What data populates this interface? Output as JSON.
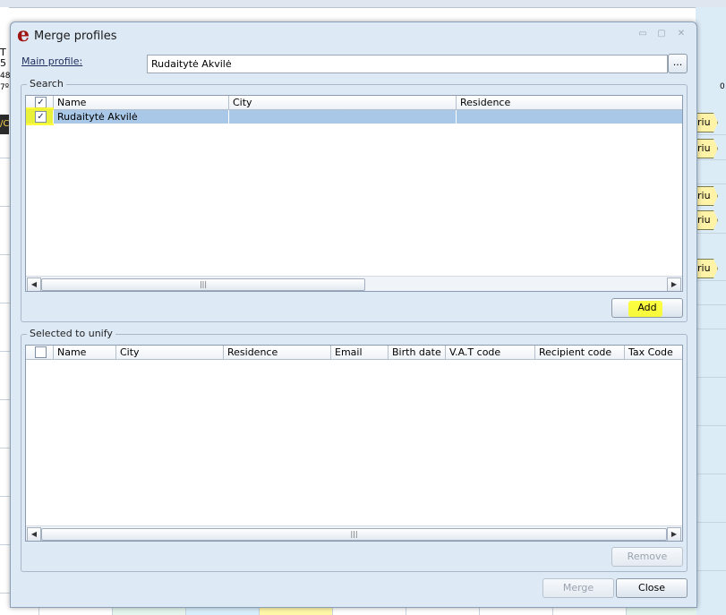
{
  "background": {
    "left_text": [
      "T",
      "5",
      "48",
      "7º"
    ],
    "dark_bar_text": "/C",
    "right_number": "0",
    "tags": [
      "riu",
      "riu",
      "riu",
      "riu",
      "riu"
    ]
  },
  "dialog": {
    "title": "Merge profiles",
    "logo_letter": "e",
    "window_controls": {
      "minimize": "▭",
      "maximize": "▢",
      "close": "✕"
    },
    "main_profile": {
      "label": "Main profile:",
      "value": "Rudaitytė Akvilė",
      "browse_label": "..."
    },
    "search": {
      "title": "Search",
      "columns": [
        "Name",
        "City",
        "Residence"
      ],
      "rows": [
        {
          "checked": true,
          "name": "Rudaitytė Akvilė",
          "city": "",
          "residence": ""
        }
      ],
      "add_button": "Add",
      "scroll_thumb_glyph": "|||"
    },
    "selected": {
      "title": "Selected to unify",
      "columns": [
        "Name",
        "City",
        "Residence",
        "Email",
        "Birth date",
        "V.A.T code",
        "Recipient code",
        "Tax Code"
      ],
      "remove_button": "Remove",
      "scroll_thumb_glyph": "|||"
    },
    "footer": {
      "merge_button": "Merge",
      "close_button": "Close"
    },
    "checkbox_glyph": "✓",
    "scroll_left_glyph": "◀",
    "scroll_right_glyph": "▶",
    "colors": {
      "selected_row": "#a9c8e8",
      "highlight": "#ffff00",
      "logo": "#a01313"
    }
  }
}
